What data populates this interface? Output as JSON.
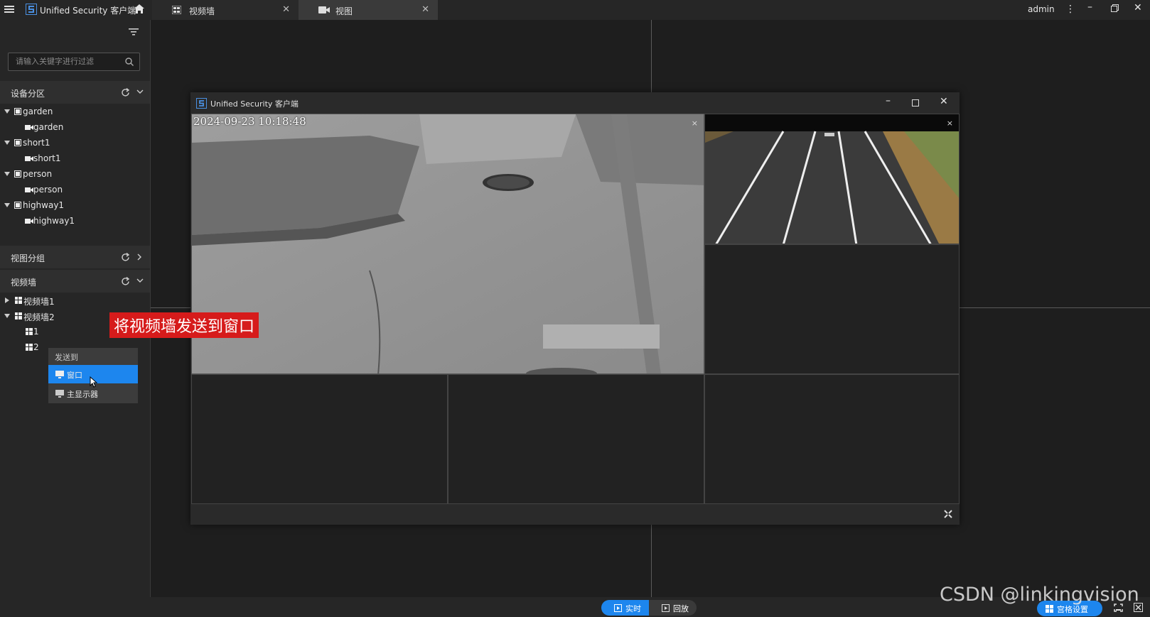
{
  "app": {
    "title": "Unified Security 客户端",
    "user": "admin"
  },
  "tabs": [
    {
      "label": "视频墙",
      "close": "✕"
    },
    {
      "label": "视图",
      "close": "✕"
    }
  ],
  "sidebar": {
    "search_placeholder": "请输入关键字进行过滤",
    "sections": {
      "devices": "设备分区",
      "views": "视图分组",
      "walls": "视频墙"
    },
    "device_tree": [
      {
        "group": "garden",
        "camera": "garden"
      },
      {
        "group": "short1",
        "camera": "short1"
      },
      {
        "group": "person",
        "camera": "person"
      },
      {
        "group": "highway1",
        "camera": "highway1"
      }
    ],
    "wall_tree": {
      "wall1": "视频墙1",
      "wall2": "视频墙2",
      "screen1": "1",
      "screen2": "2"
    }
  },
  "context_menu": {
    "header": "发送到",
    "items": [
      "窗口",
      "主显示器"
    ]
  },
  "annotation": "将视频墙发送到窗口",
  "popup": {
    "title": "Unified Security 客户端",
    "timestamp": "2024-09-23 10:18:48",
    "close_glyph": "×"
  },
  "bottom": {
    "live": "实时",
    "playback": "回放",
    "grid": "宫格设置"
  },
  "watermark": "CSDN @linkingvision",
  "colors": {
    "accent": "#1d86ee",
    "annotation": "#d61b1b",
    "background": "#1e1e1e"
  }
}
